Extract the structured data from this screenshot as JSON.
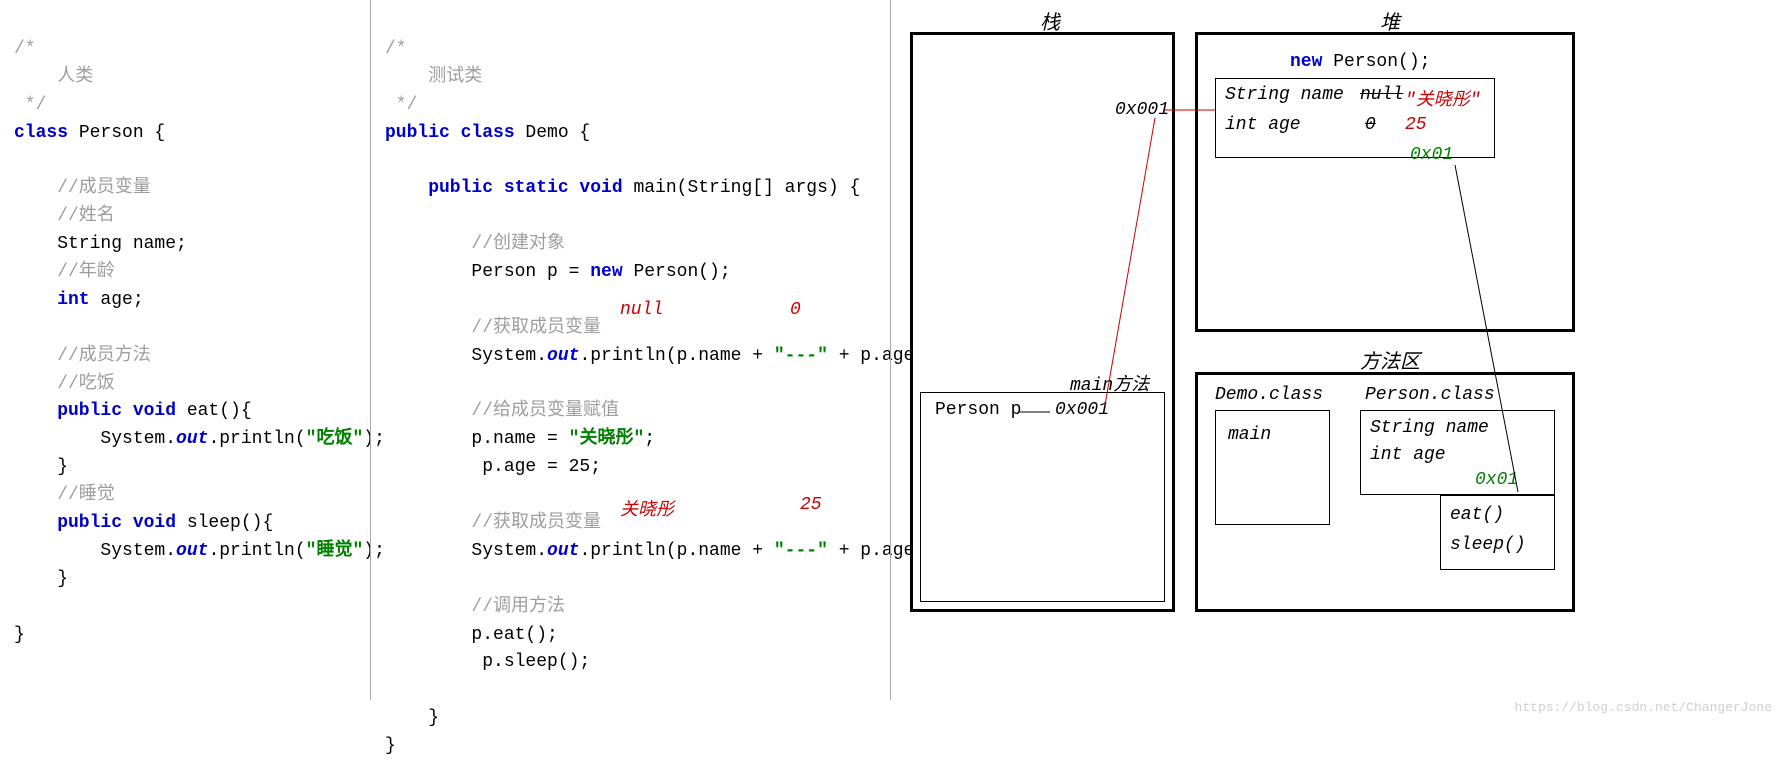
{
  "code1": {
    "c1": "/*",
    "c2": "    人类",
    "c3": " */",
    "l1a": "class",
    "l1b": " Person {",
    "c4": "    //成员变量",
    "c5": "    //姓名",
    "l2": "    String name;",
    "c6": "    //年龄",
    "l3a": "    int",
    "l3b": " age;",
    "c7": "    //成员方法",
    "c8": "    //吃饭",
    "l4a": "    public void",
    "l4b": " eat(){",
    "l5a": "        System.",
    "l5b": "out",
    "l5c": ".println(",
    "l5d": "\"吃饭\"",
    "l5e": ");",
    "l6": "    }",
    "c9": "    //睡觉",
    "l7a": "    public void",
    "l7b": " sleep(){",
    "l8a": "        System.",
    "l8b": "out",
    "l8c": ".println(",
    "l8d": "\"睡觉\"",
    "l8e": ");",
    "l9": "    }",
    "l10": "}",
    "blank": ""
  },
  "code2": {
    "c1": "/*",
    "c2": "    测试类",
    "c3": " */",
    "l1a": "public class",
    "l1b": " Demo {",
    "l2a": "    public static void",
    "l2b": " main(String[] args) {",
    "c4": "        //创建对象",
    "l3a": "        Person p = ",
    "l3b": "new",
    "l3c": " Person();",
    "c5": "        //获取成员变量",
    "l4a": "        System.",
    "l4b": "out",
    "l4c": ".println(p.name + ",
    "l4d": "\"---\"",
    "l4e": " + p.age);",
    "c6": "        //给成员变量赋值",
    "l5a": "        p.name = ",
    "l5b": "\"关晓彤\"",
    "l5c": ";",
    "l6": "         p.age = 25;",
    "c7": "        //获取成员变量",
    "l7a": "        System.",
    "l7b": "out",
    "l7c": ".println(p.name + ",
    "l7d": "\"---\"",
    "l7e": " + p.age);",
    "c8": "        //调用方法",
    "l8": "        p.eat();",
    "l9": "         p.sleep();",
    "l10": "    }",
    "l11": "}",
    "ann_null": "null",
    "ann_0": "0",
    "ann_gxt": "关晓彤",
    "ann_25": "25"
  },
  "mem": {
    "stack_label": "栈",
    "heap_label": "堆",
    "method_label": "方法区",
    "stack_addr": "0x001",
    "stack_main": "main方法",
    "stack_personp": "Person p",
    "stack_pval": "0x001",
    "heap_new": "new",
    "heap_person": " Person();",
    "heap_sn": "String name",
    "heap_null": "null",
    "heap_gxt": "\"关晓彤\"",
    "heap_ia": "int age",
    "heap_0": "0",
    "heap_25": "25",
    "heap_0x01": "0x01",
    "ma_demo": "Demo.class",
    "ma_main": "main",
    "ma_person": "Person.class",
    "ma_sn": "String name",
    "ma_ia": "int age",
    "ma_0x01": "0x01",
    "ma_eat": "eat()",
    "ma_sleep": "sleep()"
  },
  "watermark": "https://blog.csdn.net/ChangerJone"
}
